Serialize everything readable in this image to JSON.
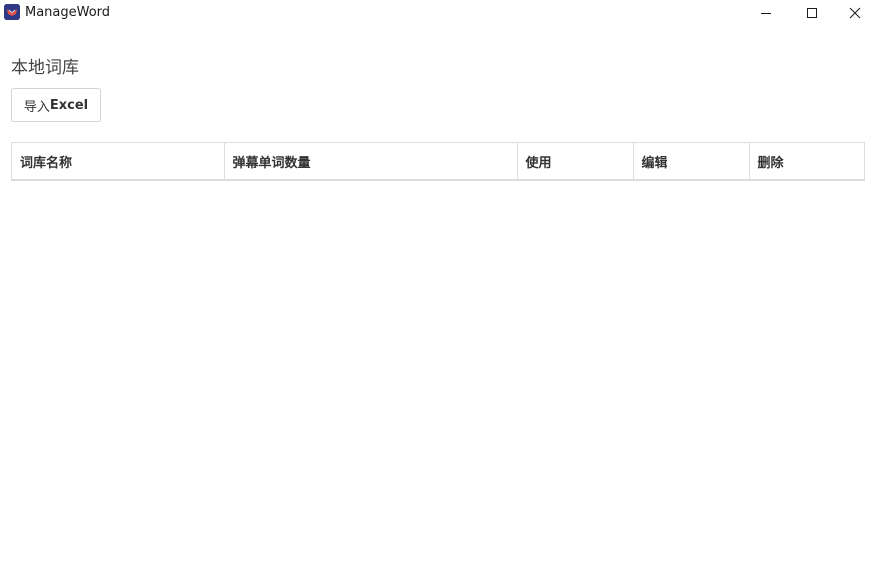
{
  "window": {
    "title": "ManageWord",
    "app_icon": "app-logo-icon",
    "controls": [
      "minimize-icon",
      "maximize-icon",
      "close-icon"
    ]
  },
  "main": {
    "section_title": "本地词库",
    "import_button": {
      "prefix": "导入",
      "bold": "Excel"
    },
    "table": {
      "columns": [
        "词库名称",
        "弹幕单词数量",
        "使用",
        "编辑",
        "删除"
      ],
      "rows": []
    }
  },
  "colors": {
    "border": "#dddddd",
    "text": "#333333",
    "app_icon_bg": "#2a3f8f",
    "app_icon_accent": "#d9534f"
  }
}
